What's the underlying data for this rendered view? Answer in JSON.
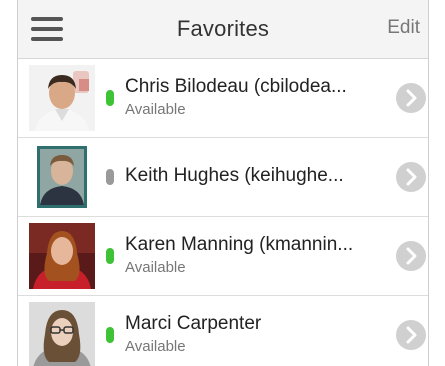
{
  "header": {
    "title": "Favorites",
    "edit_label": "Edit"
  },
  "contacts": [
    {
      "name": "Chris Bilodeau (cbilodea...",
      "status_text": "Available",
      "presence": "online"
    },
    {
      "name": "Keith Hughes (keihughe...",
      "status_text": "",
      "presence": "offline"
    },
    {
      "name": "Karen Manning (kmannin...",
      "status_text": "Available",
      "presence": "online"
    },
    {
      "name": "Marci Carpenter",
      "status_text": "Available",
      "presence": "online"
    }
  ],
  "colors": {
    "presence_online": "#3ec236",
    "presence_offline": "#9a9a9a",
    "chevron_bg": "#d0d0d0"
  },
  "icons": {
    "menu": "hamburger-menu-icon",
    "row_action": "chevron-right-icon"
  }
}
